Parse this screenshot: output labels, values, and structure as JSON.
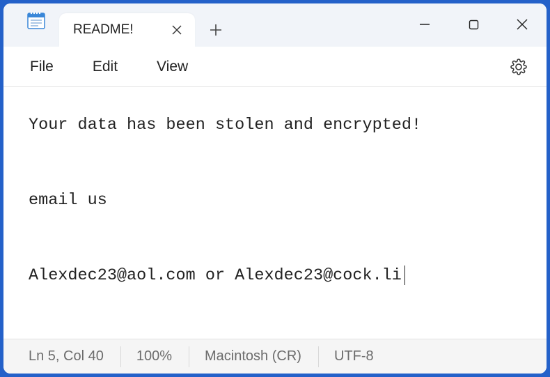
{
  "titlebar": {
    "tab_title": "README!"
  },
  "menubar": {
    "file": "File",
    "edit": "Edit",
    "view": "View"
  },
  "content": {
    "line1": "Your data has been stolen and encrypted!",
    "line2": "email us",
    "line3": "Alexdec23@aol.com or Alexdec23@cock.li"
  },
  "statusbar": {
    "position": "Ln 5, Col 40",
    "zoom": "100%",
    "line_ending": "Macintosh (CR)",
    "encoding": "UTF-8"
  }
}
